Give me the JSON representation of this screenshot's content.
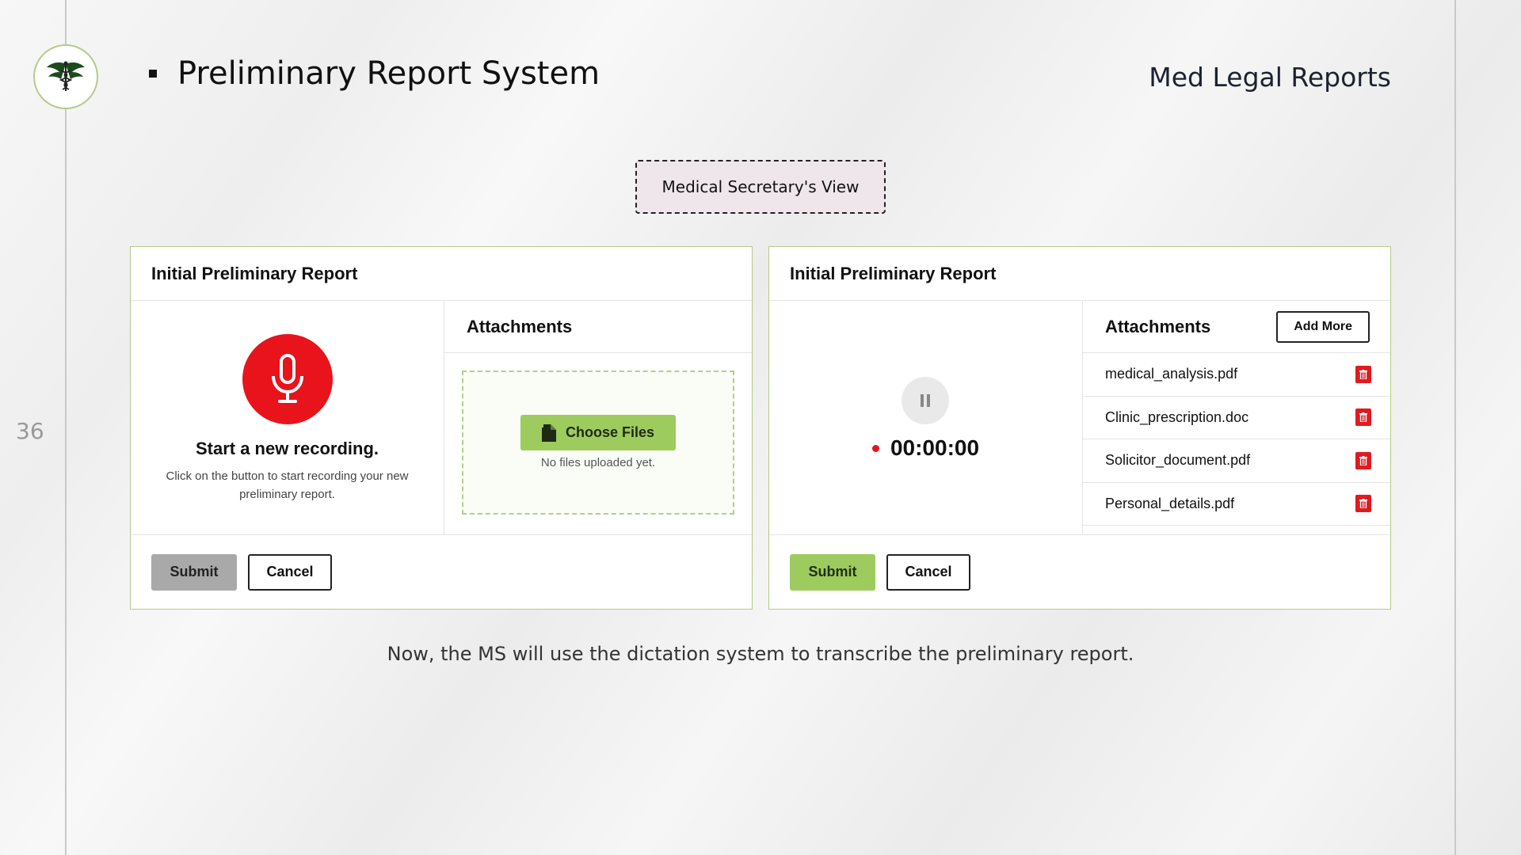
{
  "slide": {
    "page_number": "36",
    "title": "Preliminary Report System",
    "brand": "Med Legal Reports",
    "view_label": "Medical Secretary's View",
    "caption": "Now, the MS will use the dictation system to transcribe the preliminary report."
  },
  "card_left": {
    "header": "Initial Preliminary Report",
    "recording_title": "Start a new recording.",
    "recording_desc": "Click on the button to start recording your new preliminary report.",
    "attachments_title": "Attachments",
    "choose_files_label": "Choose Files",
    "no_files_text": "No files uploaded yet.",
    "submit_label": "Submit",
    "cancel_label": "Cancel"
  },
  "card_right": {
    "header": "Initial Preliminary Report",
    "timer": "00:00:00",
    "attachments_title": "Attachments",
    "add_more_label": "Add More",
    "files": [
      "medical_analysis.pdf",
      "Clinic_prescription.doc",
      "Solicitor_document.pdf",
      "Personal_details.pdf"
    ],
    "submit_label": "Submit",
    "cancel_label": "Cancel"
  },
  "colors": {
    "accent_green": "#9ecb5e",
    "record_red": "#e8131b",
    "card_border": "#b7c98a",
    "badge_bg": "#efe6ec"
  },
  "icons": [
    "caduceus-logo-icon",
    "microphone-icon",
    "file-icon",
    "pause-icon",
    "recording-dot-icon",
    "trash-icon"
  ]
}
